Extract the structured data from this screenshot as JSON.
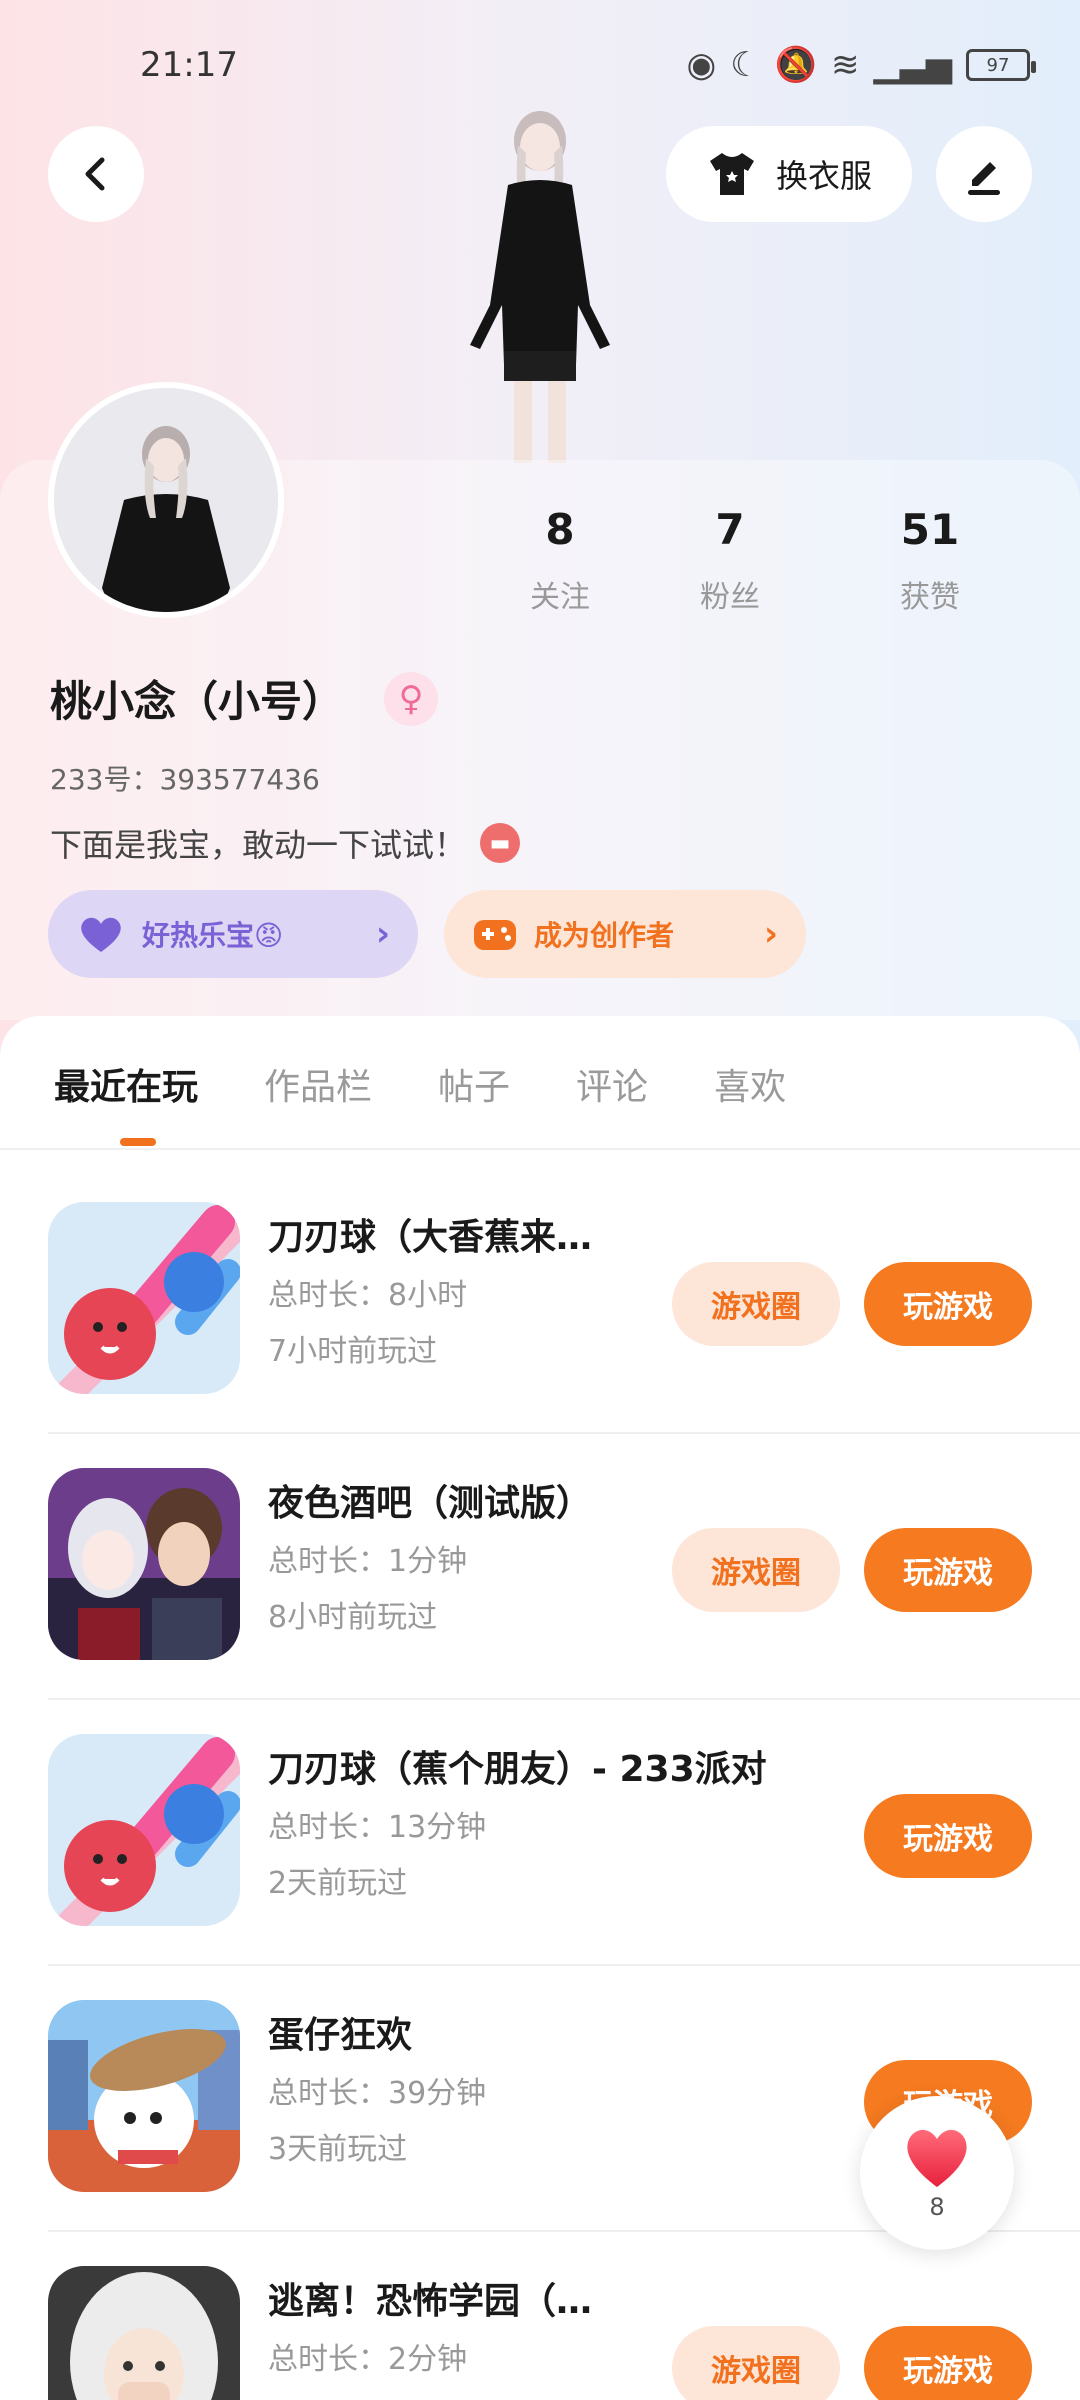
{
  "status_bar": {
    "time": "21:17",
    "battery": "97"
  },
  "header": {
    "outfit_label": "换衣服"
  },
  "profile": {
    "stats": [
      {
        "value": "8",
        "label": "关注"
      },
      {
        "value": "7",
        "label": "粉丝"
      },
      {
        "value": "51",
        "label": "获赞"
      }
    ],
    "username": "桃小念（小号）",
    "gender_symbol": "♀",
    "user_id": "233号：393577436",
    "bio": "下面是我宝，敢动一下试试！",
    "pill_fun": "好热乐宝😡",
    "pill_creator": "成为创作者"
  },
  "tabs": [
    "最近在玩",
    "作品栏",
    "帖子",
    "评论",
    "喜欢"
  ],
  "games": [
    {
      "title": "刀刃球（大香蕉来…",
      "duration": "总时长：8小时",
      "last_played": "7小时前玩过",
      "circle_label": "游戏圈",
      "play_label": "玩游戏"
    },
    {
      "title": "夜色酒吧（测试版）",
      "duration": "总时长：1分钟",
      "last_played": "8小时前玩过",
      "circle_label": "游戏圈",
      "play_label": "玩游戏"
    },
    {
      "title": "刀刃球（蕉个朋友）- 233派对",
      "duration": "总时长：13分钟",
      "last_played": "2天前玩过",
      "play_label": "玩游戏"
    },
    {
      "title": "蛋仔狂欢",
      "duration": "总时长：39分钟",
      "last_played": "3天前玩过",
      "play_label": "玩游戏"
    },
    {
      "title": "逃离！恐怖学园（…",
      "duration": "总时长：2分钟",
      "last_played": "",
      "circle_label": "游戏圈",
      "play_label": "玩游戏"
    }
  ],
  "like_fab": {
    "count": "8"
  },
  "colors": {
    "accent": "#f57a20",
    "accent_light": "#fde5d8",
    "purple": "#7a62d6"
  }
}
